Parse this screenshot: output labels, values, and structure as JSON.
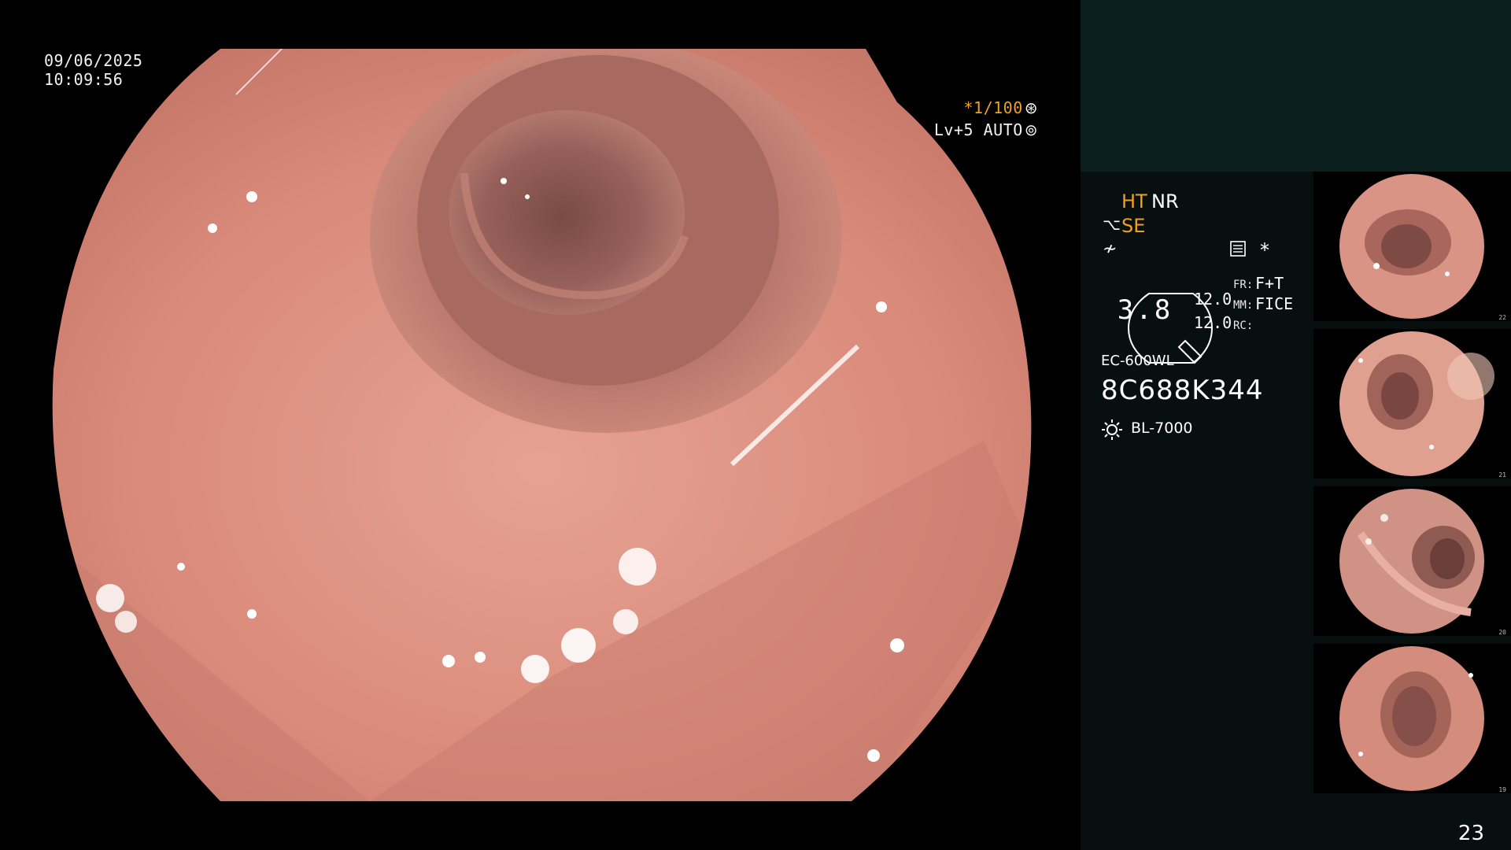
{
  "overlay": {
    "date": "09/06/2025",
    "time": "10:09:56",
    "shutter": "*1/100",
    "shutter_icon": "iris-icon",
    "level": "Lv+5 AUTO",
    "level_icon": "aperture-icon"
  },
  "info": {
    "ht": "HT",
    "nr": "NR",
    "se": "SE",
    "se_icon": "structure-enhance-icon",
    "sharp_icon": "sharpness-icon",
    "panel_icon": "settings-panel-icon",
    "star": "*",
    "gauge_value": "3.8",
    "value_1": "12.0",
    "value_2": "12.0",
    "fr_key": "FR:",
    "fr_value": "F+T",
    "mm_key": "MM:",
    "mm_value": "FICE",
    "rc_key": "RC:",
    "scope_model": "EC-600WL",
    "serial": "8C688K344",
    "light_icon": "light-source-icon",
    "light_model": "BL-7000"
  },
  "thumbnails": [
    {
      "number": "22"
    },
    {
      "number": "21"
    },
    {
      "number": "20"
    },
    {
      "number": "19"
    }
  ],
  "page_number": "23",
  "colors": {
    "accent": "#f0a020",
    "panel_bg": "#07100f",
    "panel_header": "#0b1f1f",
    "mucosa": "#d98a7a"
  }
}
